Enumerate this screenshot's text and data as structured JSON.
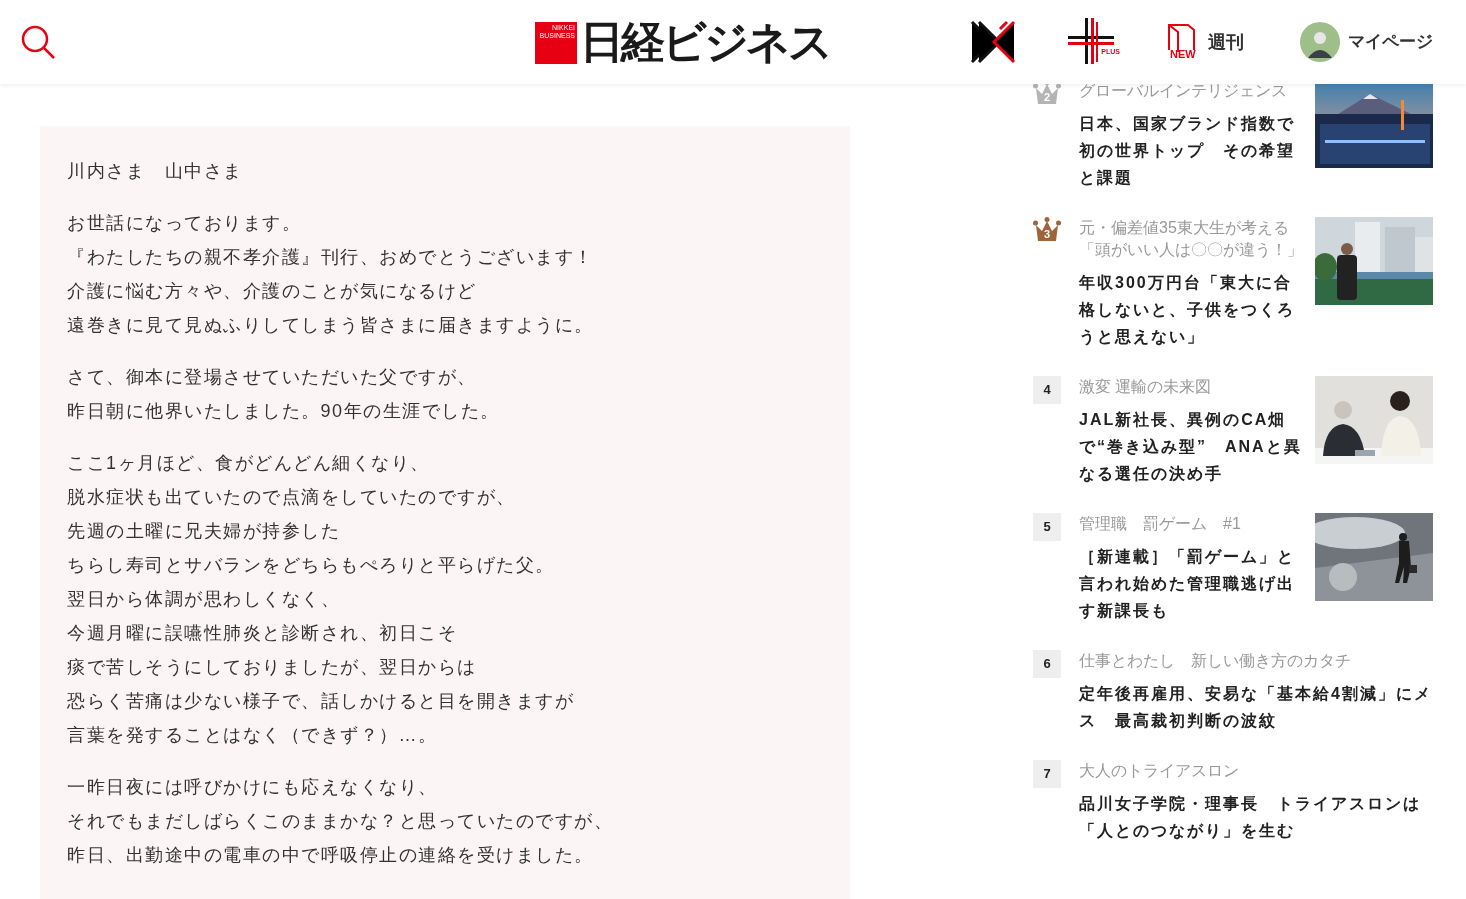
{
  "header": {
    "logo": {
      "mark_text": "NIKKEI BUSINESS",
      "title": "日経ビジネス"
    },
    "plus_label": "PLUS",
    "weekly": {
      "badge": "NEW",
      "label": "週刊"
    },
    "mypage": "マイページ"
  },
  "letter": {
    "paragraphs": [
      [
        "川内さま　山中さま"
      ],
      [
        "お世話になっております。",
        "『わたしたちの親不孝介護』刊行、おめでとうございます！",
        "介護に悩む方々や、介護のことが気になるけど",
        "遠巻きに見て見ぬふりしてしまう皆さまに届きますように。"
      ],
      [
        "さて、御本に登場させていただいた父ですが、",
        "昨日朝に他界いたしました。90年の生涯でした。"
      ],
      [
        "ここ1ヶ月ほど、食がどんどん細くなり、",
        "脱水症状も出ていたので点滴をしていたのですが、",
        "先週の土曜に兄夫婦が持参した",
        "ちらし寿司とサバランをどちらもぺろりと平らげた父。",
        "翌日から体調が思わしくなく、",
        "今週月曜に誤嚥性肺炎と診断され、初日こそ",
        "痰で苦しそうにしておりましたが、翌日からは",
        "恐らく苦痛は少ない様子で、話しかけると目を開きますが",
        "言葉を発することはなく（できず？）…。"
      ],
      [
        "一昨日夜には呼びかけにも応えなくなり、",
        "それでもまだしばらくこのままかな？と思っていたのですが、",
        "昨日、出勤途中の電車の中で呼吸停止の連絡を受けました。"
      ]
    ]
  },
  "ranking": [
    {
      "rank": "2",
      "kind": "crown",
      "color": "#b4b4b4",
      "category": "グローバルインテリジェンス",
      "title": "日本、国家ブランド指数で初の世界トップ　その希望と課題"
    },
    {
      "rank": "3",
      "kind": "crown",
      "color": "#a0643c",
      "category": "元・偏差値35東大生が考える「頭がいい人は〇〇が違う！」",
      "title": "年収300万円台「東大に合格しないと、子供をつくろうと思えない」"
    },
    {
      "rank": "4",
      "kind": "box",
      "category": "激変 運輸の未来図",
      "title": "JAL新社長、異例のCA畑で“巻き込み型”　ANAと異なる選任の決め手"
    },
    {
      "rank": "5",
      "kind": "box",
      "category": "管理職　罰ゲーム　#1",
      "title": "［新連載］「罰ゲーム」と言われ始めた管理職逃げ出す新課長も"
    },
    {
      "rank": "6",
      "kind": "box",
      "category": "仕事とわたし　新しい働き方のカタチ",
      "title": "定年後再雇用、安易な「基本給4割減」にメス　最高裁初判断の波紋"
    },
    {
      "rank": "7",
      "kind": "box",
      "category": "大人のトライアスロン",
      "title": "品川女子学院・理事長　トライアスロンは「人とのつながり」を生む"
    }
  ]
}
